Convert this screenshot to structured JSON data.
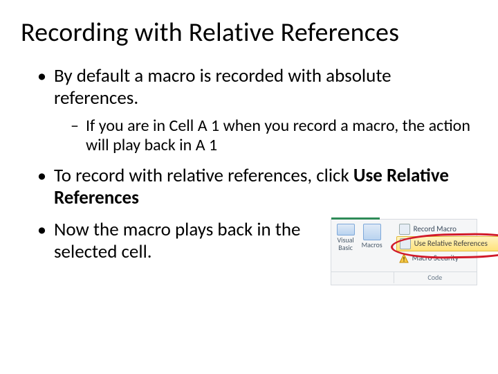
{
  "title": "Recording with Relative References",
  "bullets": {
    "b1_plain": "By default a macro is recorded with absolute references.",
    "b1_sub": "If you are in Cell A 1 when you record a macro, the action will play back in A 1",
    "b2_prefix": "To record with relative references, click ",
    "b2_bold": "Use Relative References",
    "b3": "Now the macro plays back in the selected cell."
  },
  "ribbon": {
    "visual_basic": "Visual Basic",
    "macros": "Macros",
    "record_macro": "Record Macro",
    "use_relative_refs": "Use Relative References",
    "macro_security": "Macro Security",
    "group_code": "Code"
  }
}
